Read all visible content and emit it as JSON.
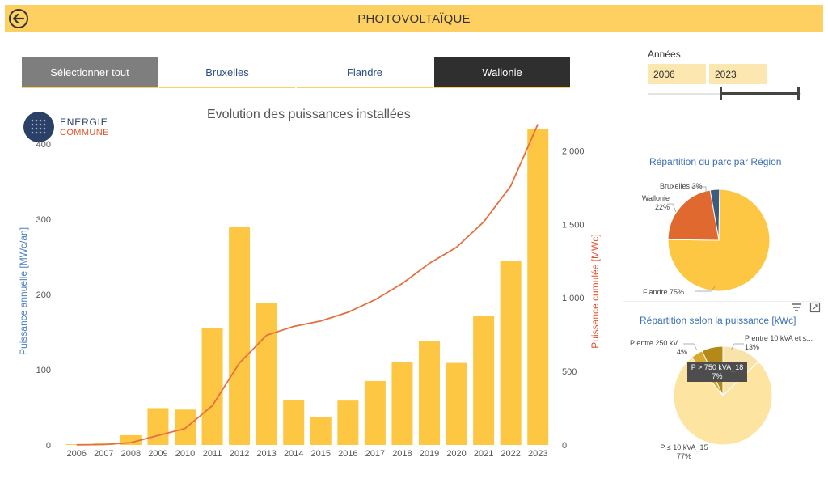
{
  "header": {
    "title": "PHOTOVOLTAÏQUE",
    "back_icon": "back-arrow-icon"
  },
  "tabs": [
    {
      "label": "Sélectionner tout"
    },
    {
      "label": "Bruxelles"
    },
    {
      "label": "Flandre"
    },
    {
      "label": "Wallonie"
    }
  ],
  "years": {
    "label": "Années",
    "start": "2006",
    "end": "2023"
  },
  "logo": {
    "line1": "ENERGIE",
    "line2": "COMMUNE"
  },
  "colors": {
    "bar": "#fec743",
    "line": "#e5703e",
    "header": "#fdd061"
  },
  "chart_data": [
    {
      "type": "bar",
      "title": "Evolution des puissances installées",
      "ylabel": "Puissance annuelle [MWc/an]",
      "y2label": "Puissance cumulée [MWc]",
      "categories": [
        "2006",
        "2007",
        "2008",
        "2009",
        "2010",
        "2011",
        "2012",
        "2013",
        "2014",
        "2015",
        "2016",
        "2017",
        "2018",
        "2019",
        "2020",
        "2021",
        "2022",
        "2023"
      ],
      "series": [
        {
          "type": "bar",
          "axis": "left",
          "values": [
            1,
            2,
            13,
            49,
            47,
            155,
            290,
            189,
            60,
            37,
            59,
            85,
            110,
            138,
            109,
            172,
            245,
            420
          ]
        },
        {
          "type": "line",
          "axis": "right",
          "values": [
            1,
            3,
            16,
            65,
            112,
            267,
            557,
            746,
            806,
            843,
            902,
            987,
            1097,
            1235,
            1344,
            1516,
            1761,
            2181
          ]
        }
      ],
      "ylim": [
        0,
        430
      ],
      "y2lim": [
        0,
        2200
      ],
      "yticks": [
        0,
        100,
        200,
        300,
        400
      ],
      "y2ticks": [
        0,
        500,
        1000,
        1500,
        2000
      ],
      "y2tick_labels": [
        "0",
        "500",
        "1 000",
        "1 500",
        "2 000"
      ],
      "grid": false
    },
    {
      "type": "pie",
      "title": "Répartition du parc par Région",
      "slices": [
        {
          "label": "Bruxelles 3%",
          "value": 3,
          "color": "#3d5a80"
        },
        {
          "label": "Flandre 75%",
          "value": 75,
          "color": "#fec743"
        },
        {
          "label": "Wallonie 22%",
          "value": 22,
          "color": "#e06930"
        }
      ]
    },
    {
      "type": "pie",
      "title": "Répartition  selon la puissance [kWc]",
      "slices": [
        {
          "label": "P entre 10 kVA et ≤...",
          "pct": "13%",
          "value": 13,
          "color": "#f8e3aa"
        },
        {
          "label": "P ≤ 10 kVA_15",
          "pct": "77%",
          "value": 77,
          "color": "#fde4a0"
        },
        {
          "label": "P entre 250 kV...",
          "pct": "4%",
          "value": 4,
          "color": "#d9a92f"
        },
        {
          "label": "P > 750 kVA_18",
          "pct": "7%",
          "value": 7,
          "color": "#b48918"
        }
      ],
      "tooltip": {
        "line1": "P > 750 kVA_18",
        "line2": "7%"
      }
    }
  ]
}
